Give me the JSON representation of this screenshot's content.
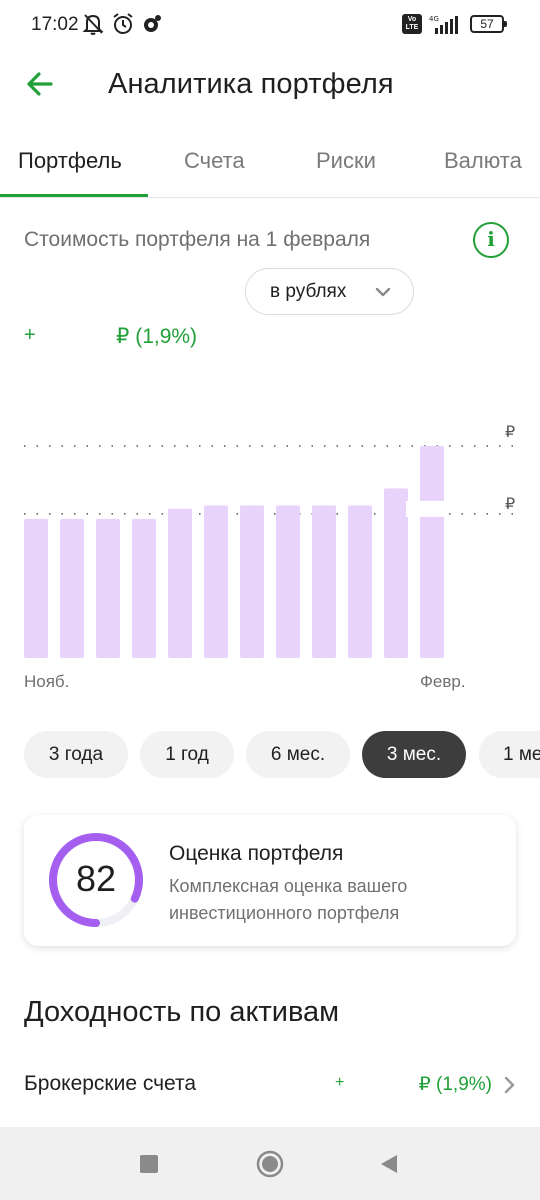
{
  "status_bar": {
    "time": "17:02",
    "left_icons": [
      "bell-off-icon",
      "alarm-icon",
      "app-notification-icon"
    ],
    "volte": "Vo LTE",
    "network": "4G",
    "battery": "57"
  },
  "header": {
    "title": "Аналитика портфеля",
    "back_icon": "arrow-left-icon"
  },
  "tabs": [
    {
      "label": "Портфель",
      "active": true
    },
    {
      "label": "Счета",
      "active": false
    },
    {
      "label": "Риски",
      "active": false
    },
    {
      "label": "Валюта",
      "active": false
    }
  ],
  "portfolio": {
    "title": "Стоимость портфеля на 1 февраля",
    "info_icon": "i",
    "currency_select": "в рублях",
    "change_plus": "+",
    "change_value": "₽ (1,9%)"
  },
  "chart_data": {
    "type": "bar",
    "values": [
      0.82,
      0.82,
      0.82,
      0.82,
      0.88,
      0.9,
      0.9,
      0.9,
      0.9,
      0.9,
      1.0,
      1.25
    ],
    "max": 1.25,
    "x_labels": [
      "Нояб.",
      "Февр."
    ],
    "grid_labels": [
      "₽",
      "₽"
    ],
    "color": "#e8d4fa"
  },
  "periods": [
    {
      "label": "3 года",
      "active": false
    },
    {
      "label": "1 год",
      "active": false
    },
    {
      "label": "6 мес.",
      "active": false
    },
    {
      "label": "3 мес.",
      "active": true
    },
    {
      "label": "1 ме",
      "active": false
    }
  ],
  "score_card": {
    "score": "82",
    "score_fraction": 0.82,
    "title": "Оценка портфеля",
    "description": "Комплексная оценка вашего инвестиционного портфеля",
    "ring_color": "#a45ff0"
  },
  "assets": {
    "section_title": "Доходность по активам",
    "rows": [
      {
        "name": "Брокерские счета",
        "plus": "+",
        "change": "₽ (1,9%)"
      }
    ]
  },
  "colors": {
    "accent": "#21a038",
    "bar": "#e8d4fa",
    "chip_active": "#3d3d3d"
  }
}
